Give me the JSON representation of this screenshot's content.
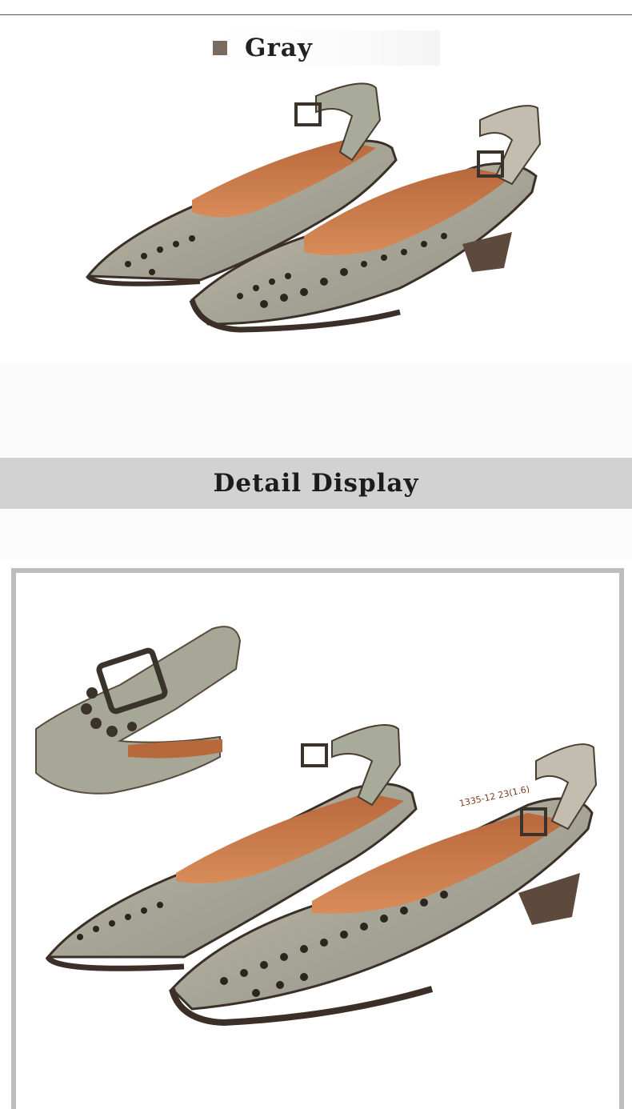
{
  "colors": {
    "swatch": "#7a6a60",
    "section_bar": "#d2d2d2",
    "frame_border": "#bdbdbd"
  },
  "color_variant": {
    "name": "Gray",
    "swatch_icon": "square-swatch-icon"
  },
  "sections": {
    "detail_title": "Detail  Display"
  },
  "images": {
    "top": "photo of a pair of gray floral-perforated pointed-toe slingback shoes with buckle",
    "detail": "detail photo of buckle close-up and pair of gray perforated slingback shoes"
  },
  "insole_print": "1335-12 23(1.6)"
}
